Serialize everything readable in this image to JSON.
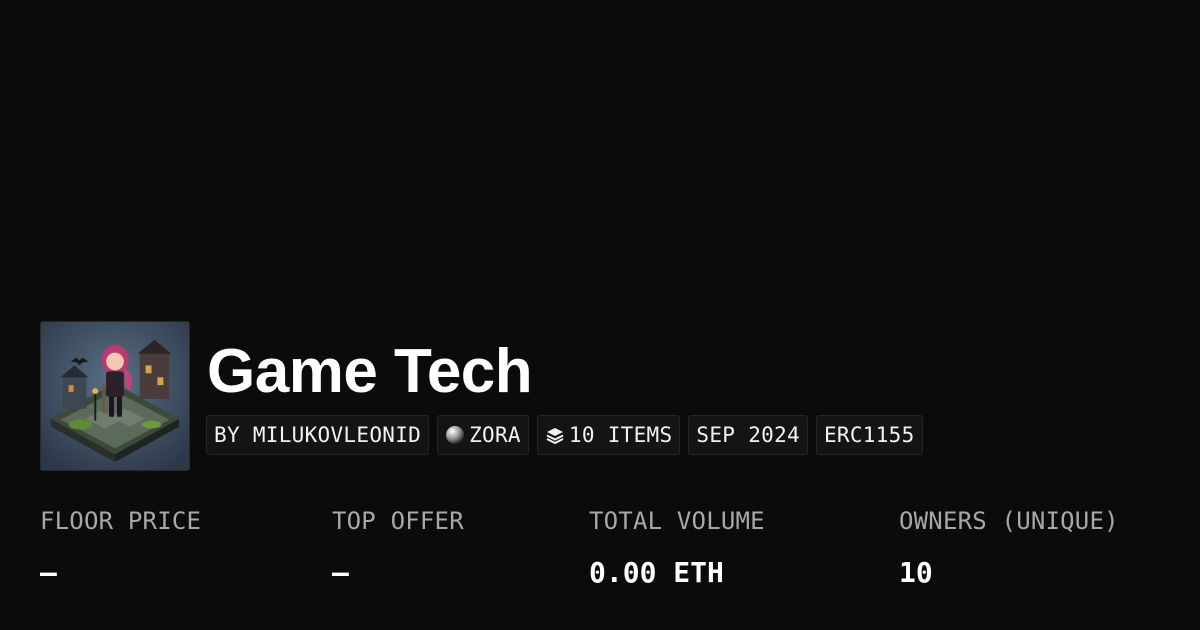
{
  "collection": {
    "title": "Game Tech",
    "thumbnail_alt": "isometric-game-character-artwork"
  },
  "tags": {
    "creator": "BY MILUKOVLEONID",
    "chain": "ZORA",
    "chain_icon": "sphere-icon",
    "items": "10 ITEMS",
    "items_icon": "layers-icon",
    "date": "SEP 2024",
    "standard": "ERC1155"
  },
  "stats": {
    "floor_price": {
      "label": "FLOOR PRICE",
      "value": "–"
    },
    "top_offer": {
      "label": "TOP OFFER",
      "value": "–"
    },
    "total_volume": {
      "label": "TOTAL VOLUME",
      "value": "0.00 ETH"
    },
    "owners": {
      "label": "OWNERS (UNIQUE)",
      "value": "10"
    }
  },
  "colors": {
    "background": "#0b0b0b",
    "text": "#ffffff",
    "muted": "#a8a8a8",
    "tag_bg": "#141414",
    "tag_border": "#252525"
  }
}
